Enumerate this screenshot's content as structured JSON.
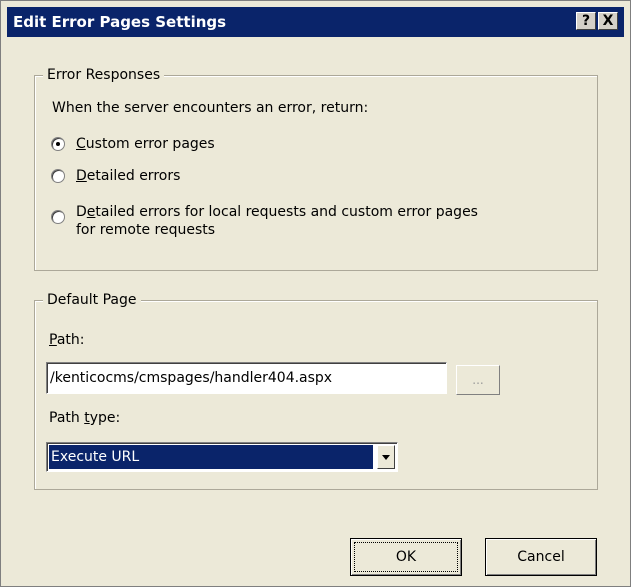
{
  "window": {
    "title": "Edit Error Pages Settings",
    "help_label": "?",
    "close_label": "X"
  },
  "error_responses": {
    "legend": "Error Responses",
    "prompt": "When the server encounters an error, return:",
    "options": [
      {
        "label": "Custom error pages",
        "selected": true
      },
      {
        "label": "Detailed errors",
        "selected": false
      },
      {
        "label_line1": "Detailed errors for local requests and custom error pages",
        "label_line2": "for remote requests",
        "selected": false
      }
    ]
  },
  "default_page": {
    "legend": "Default Page",
    "path_label": "Path:",
    "path_value": "/kenticocms/cmspages/handler404.aspx",
    "browse_label": "...",
    "path_type_label": "Path type:",
    "path_type_value": "Execute URL"
  },
  "buttons": {
    "ok_label": "OK",
    "cancel_label": "Cancel"
  },
  "colors": {
    "title_bar": "#0a246a",
    "dialog_face": "#ece9d8",
    "selection": "#0a246a"
  }
}
